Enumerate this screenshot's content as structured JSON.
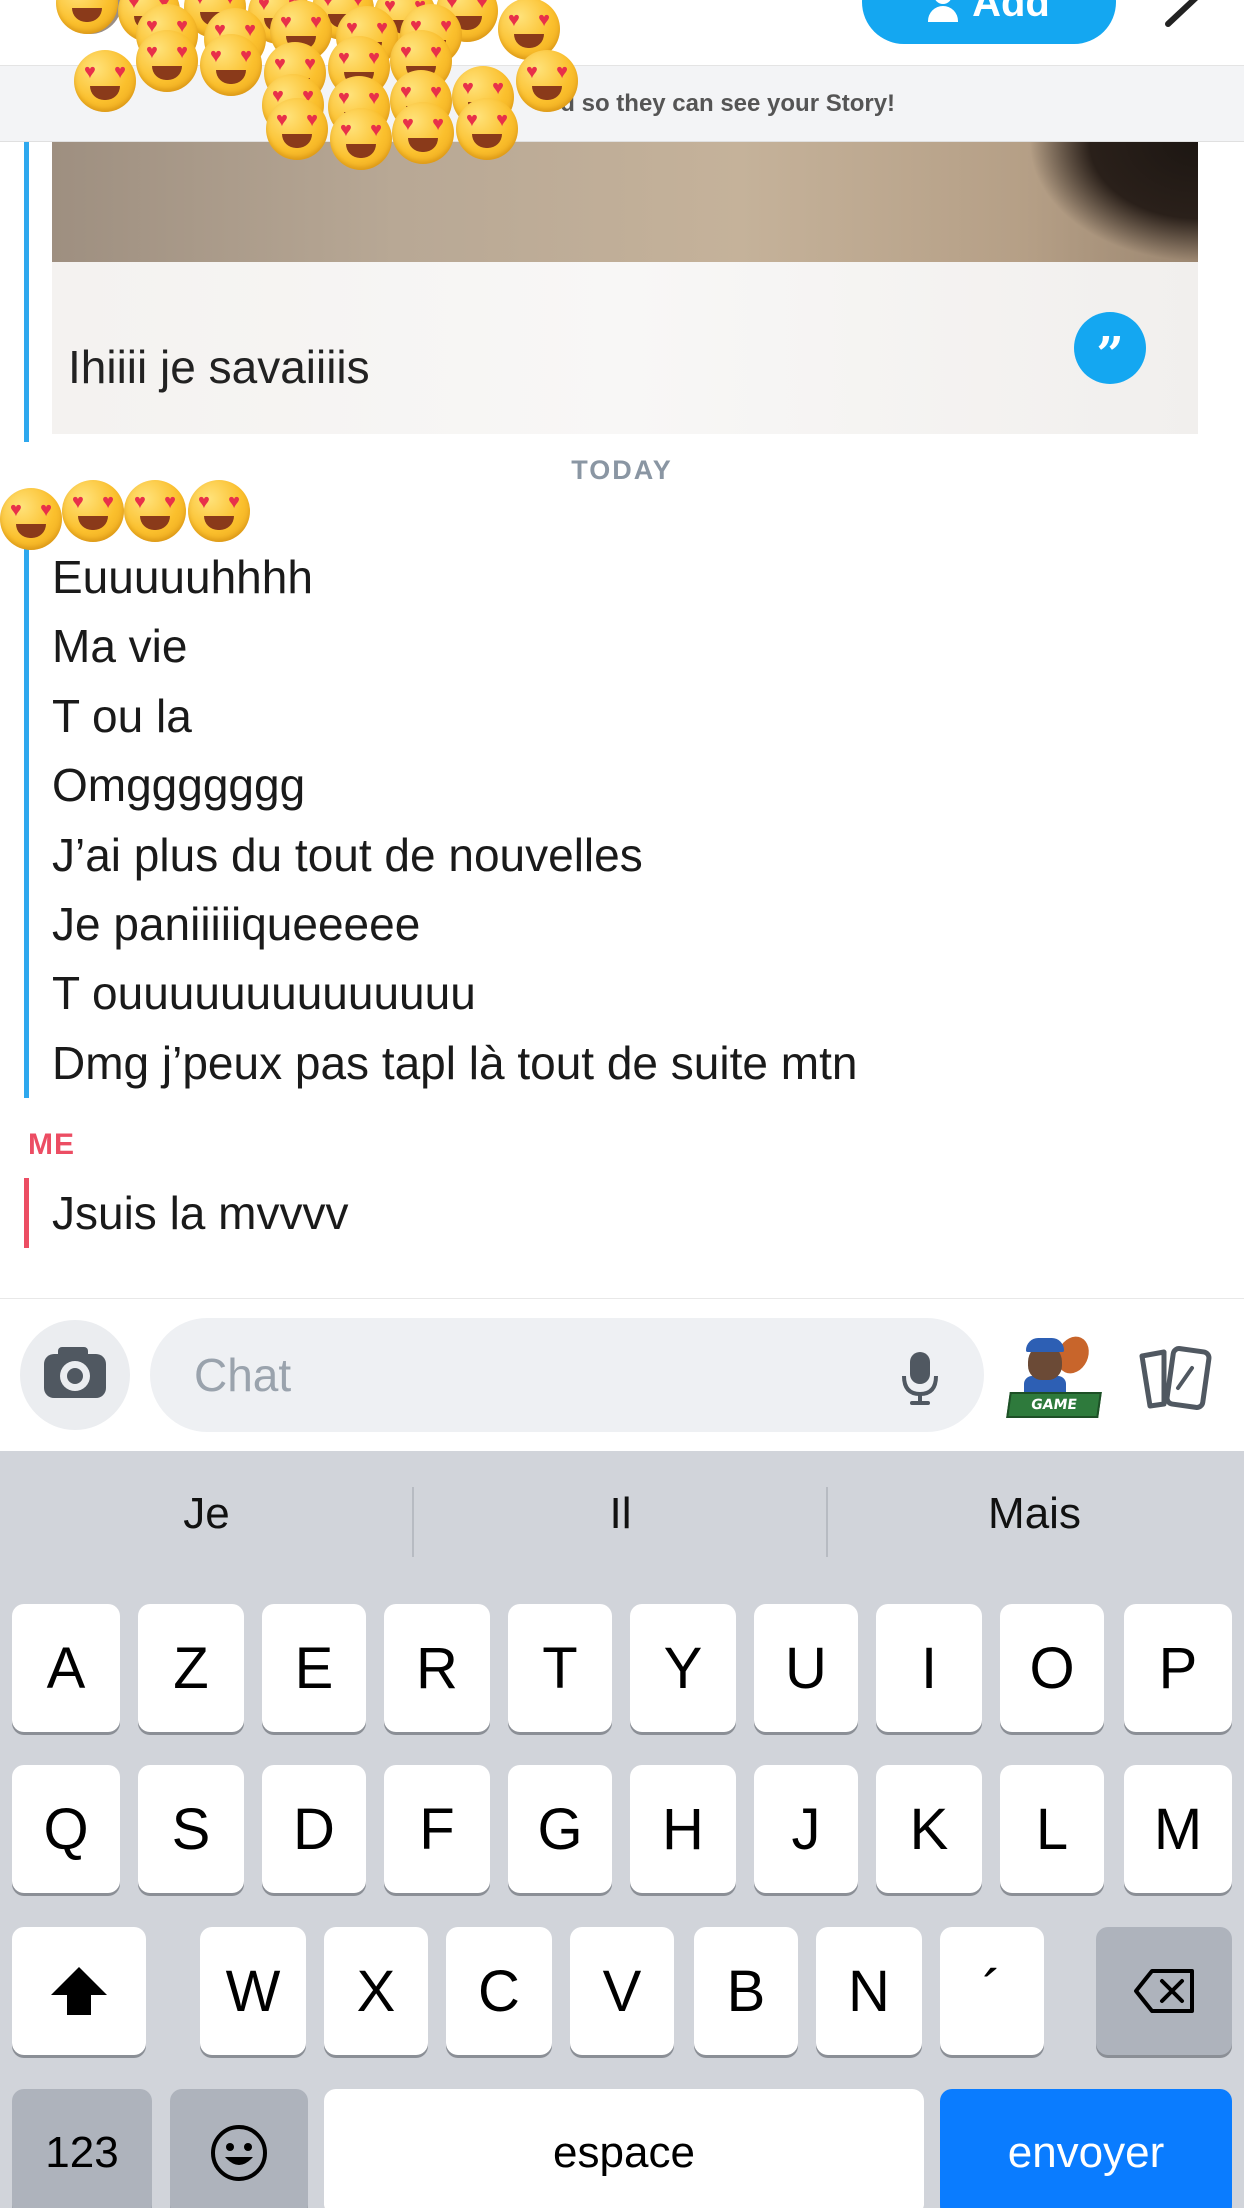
{
  "header": {
    "add_label": "Add",
    "banner_text_start": "A",
    "banner_text_end": "d so they can see your Story!"
  },
  "snap": {
    "caption": "Ihiiii je savaiiiis",
    "quote_icon": "quote-icon"
  },
  "date_separator": "TODAY",
  "conversation": {
    "them_sender": "",
    "me_sender": "ME",
    "them_messages": [
      "Euuuuuhhhh",
      "Ma vie",
      "T ou la",
      "Omggggggg",
      "J’ai plus du tout de nouvelles",
      "Je paniiiiiqueeeee",
      "T ouuuuuuuuuuuuuu",
      "Dmg j’peux pas tapl là tout de suite mtn"
    ],
    "me_messages": [
      "Jsuis la mvvvv"
    ]
  },
  "input": {
    "placeholder": "Chat",
    "value": "",
    "bitmoji_label": "GAME TIME!"
  },
  "keyboard": {
    "suggestions": [
      "Je",
      "Il",
      "Mais"
    ],
    "row1": [
      "A",
      "Z",
      "E",
      "R",
      "T",
      "Y",
      "U",
      "I",
      "O",
      "P"
    ],
    "row2": [
      "Q",
      "S",
      "D",
      "F",
      "G",
      "H",
      "J",
      "K",
      "L",
      "M"
    ],
    "row3": [
      "W",
      "X",
      "C",
      "V",
      "B",
      "N",
      "´"
    ],
    "numbers_label": "123",
    "space_label": "espace",
    "send_label": "envoyer"
  },
  "colors": {
    "accent_blue": "#14a7f1",
    "me_red": "#ec4d63",
    "them_blue": "#2ea8ee",
    "keyboard_bg": "#d1d4da",
    "send_key": "#0a7cff"
  }
}
